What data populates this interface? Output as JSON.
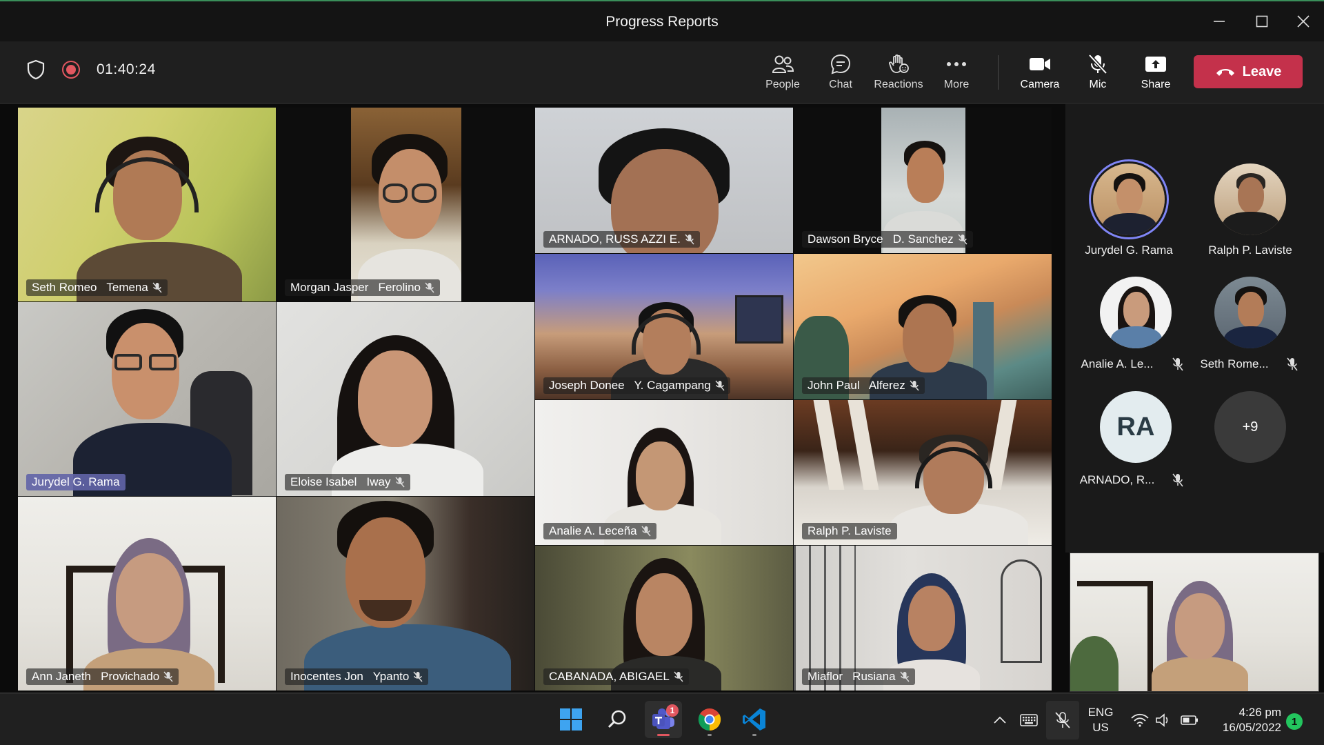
{
  "window": {
    "title": "Progress Reports"
  },
  "meeting": {
    "timer": "01:40:24",
    "toolbar": {
      "people": "People",
      "chat": "Chat",
      "reactions": "Reactions",
      "more": "More",
      "camera": "Camera",
      "mic": "Mic",
      "share": "Share",
      "leave": "Leave"
    }
  },
  "tiles": [
    {
      "name": "Seth Romeo   Temena"
    },
    {
      "name": "Morgan Jasper   Ferolino"
    },
    {
      "name": "ARNADO, RUSS AZZI E."
    },
    {
      "name": "Dawson Bryce   D. Sanchez"
    },
    {
      "name": "Joseph Donee   Y. Cagampang"
    },
    {
      "name": "John Paul   Alferez"
    },
    {
      "name": "Jurydel G. Rama"
    },
    {
      "name": "Eloise Isabel   Iway"
    },
    {
      "name": "Analie A. Leceña"
    },
    {
      "name": "Ralph P. Laviste"
    },
    {
      "name": "Ann Janeth   Provichado"
    },
    {
      "name": "Inocentes Jon   Ypanto"
    },
    {
      "name": "CABANADA, ABIGAEL"
    },
    {
      "name": "Miaflor   Rusiana"
    }
  ],
  "participants_panel": {
    "items": [
      {
        "name": "Jurydel G. Rama"
      },
      {
        "name": "Ralph P. Laviste"
      },
      {
        "name": "Analie A. Le..."
      },
      {
        "name": "Seth Rome..."
      },
      {
        "name": "ARNADO, R...",
        "initials": "RA"
      }
    ],
    "overflow": "+9"
  },
  "taskbar": {
    "teams_badge": "1",
    "language": [
      "ENG",
      "US"
    ],
    "time": "4:26 pm",
    "date": "16/05/2022",
    "notifications": "1"
  }
}
